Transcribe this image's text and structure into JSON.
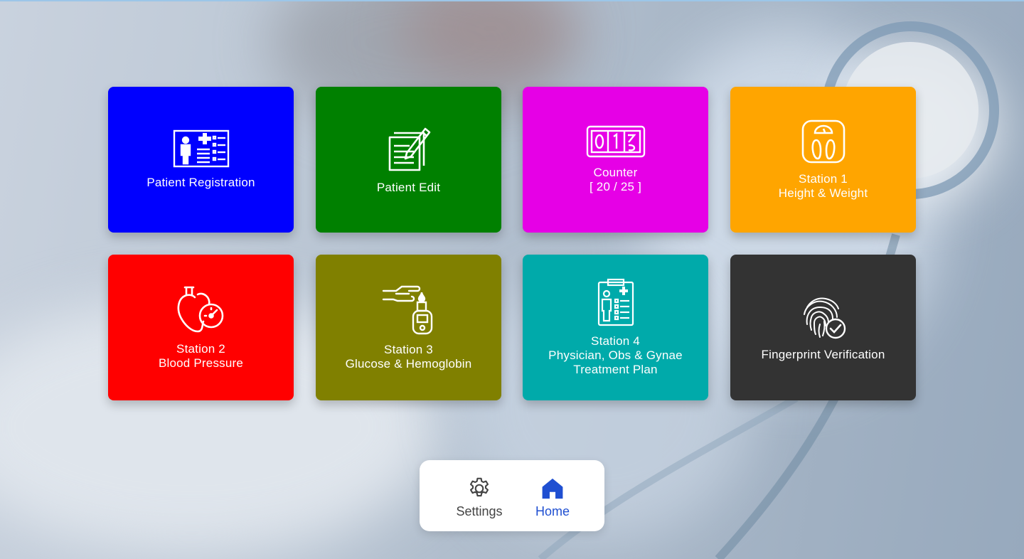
{
  "tiles": [
    {
      "label_lines": [
        "Patient Registration"
      ],
      "color": "#0000ff",
      "icon": "patient-card-icon"
    },
    {
      "label_lines": [
        "Patient Edit"
      ],
      "color": "#008000",
      "icon": "edit-form-icon"
    },
    {
      "label_lines": [
        "Counter",
        "[ 20 / 25 ]"
      ],
      "color": "#e600e6",
      "icon": "counter-icon"
    },
    {
      "label_lines": [
        "Station 1",
        "Height & Weight"
      ],
      "color": "#ffa500",
      "icon": "weighing-scale-icon"
    },
    {
      "label_lines": [
        "Station 2",
        "Blood Pressure"
      ],
      "color": "#ff0000",
      "icon": "heart-gauge-icon"
    },
    {
      "label_lines": [
        "Station 3",
        "Glucose & Hemoglobin"
      ],
      "color": "#808000",
      "icon": "glucometer-icon"
    },
    {
      "label_lines": [
        "Station 4",
        "Physician, Obs & Gynae",
        "Treatment Plan"
      ],
      "color": "#00aaaa",
      "icon": "clipboard-doctor-icon"
    },
    {
      "label_lines": [
        "Fingerprint Verification"
      ],
      "color": "#333333",
      "icon": "fingerprint-check-icon"
    }
  ],
  "nav": {
    "settings_label": "Settings",
    "home_label": "Home",
    "active": "home",
    "active_color": "#1f4fd1",
    "inactive_color": "#444444"
  }
}
